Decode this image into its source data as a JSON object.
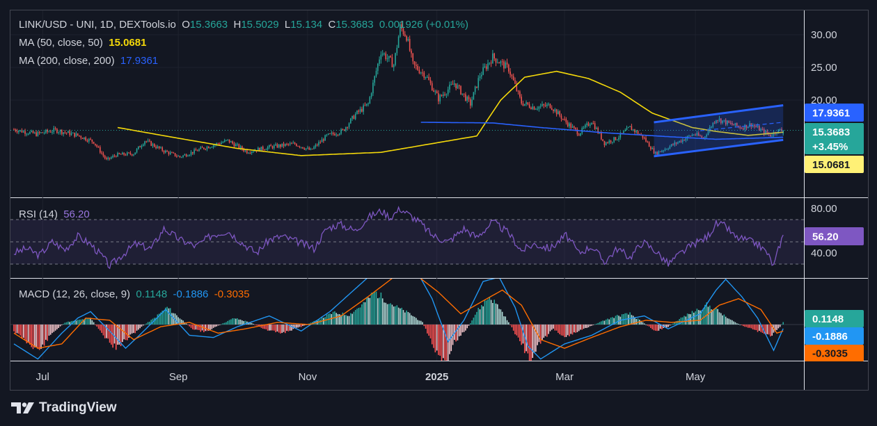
{
  "header": {
    "symbol": "LINK/USD - UNI, 1D, DEXTools.io",
    "open_label": "O",
    "open": "15.3663",
    "high_label": "H",
    "high": "15.5029",
    "low_label": "L",
    "low": "15.134",
    "close_label": "C",
    "close": "15.3683",
    "change": "0.001926 (+0.01%)"
  },
  "ma50": {
    "label": "MA (50, close, 50)",
    "value": "15.0681",
    "color": "#f5d90a"
  },
  "ma200": {
    "label": "MA (200, close, 200)",
    "value": "17.9361",
    "color": "#2962ff"
  },
  "rsi": {
    "label": "RSI (14)",
    "value": "56.20",
    "color": "#7e57c2"
  },
  "macd": {
    "label": "MACD (12, 26, close, 9)",
    "hist": "0.1148",
    "macd": "-0.1886",
    "signal": "-0.3035"
  },
  "badges": {
    "ma200": "17.9361",
    "price": "15.3683",
    "pct": "+3.45%",
    "ma50": "15.0681",
    "rsi": "56.20",
    "hist": "0.1148",
    "macd": "-0.1886",
    "signal": "-0.3035"
  },
  "colors": {
    "up": "#26a69a",
    "down": "#ef5350",
    "bg": "#131722",
    "text": "#d1d4dc",
    "macd": "#2196f3",
    "signal": "#ff6d00",
    "channel": "#2962ff"
  },
  "brand": "TradingView",
  "chart_data": [
    {
      "type": "candlestick",
      "title": "LINK/USD - UNI, 1D, DEXTools.io",
      "x_ticks": [
        "Jul",
        "Sep",
        "Nov",
        "2025",
        "Mar",
        "May"
      ],
      "y_ticks": [
        "30.00",
        "25.00",
        "20.00"
      ],
      "ylim": [
        8,
        32
      ],
      "current": {
        "open": 15.3663,
        "high": 15.5029,
        "low": 15.134,
        "close": 15.3683
      },
      "waypoints": [
        [
          0,
          15.5
        ],
        [
          14,
          14.8
        ],
        [
          26,
          15.4
        ],
        [
          40,
          14.6
        ],
        [
          50,
          13.6
        ],
        [
          58,
          10.8
        ],
        [
          64,
          11.6
        ],
        [
          75,
          11.8
        ],
        [
          82,
          13.8
        ],
        [
          94,
          12.2
        ],
        [
          104,
          11.3
        ],
        [
          118,
          12.6
        ],
        [
          134,
          13.8
        ],
        [
          146,
          12.1
        ],
        [
          160,
          12.8
        ],
        [
          176,
          13.3
        ],
        [
          186,
          12.3
        ],
        [
          196,
          14.5
        ],
        [
          206,
          15.3
        ],
        [
          214,
          17.8
        ],
        [
          222,
          19.4
        ],
        [
          230,
          27.5
        ],
        [
          238,
          25.4
        ],
        [
          242,
          31.2
        ],
        [
          246,
          29.8
        ],
        [
          250,
          25.4
        ],
        [
          258,
          23.8
        ],
        [
          266,
          20.2
        ],
        [
          276,
          22.6
        ],
        [
          286,
          19.4
        ],
        [
          292,
          23.8
        ],
        [
          300,
          26.6
        ],
        [
          310,
          24.8
        ],
        [
          318,
          19.6
        ],
        [
          326,
          18.9
        ],
        [
          336,
          19.2
        ],
        [
          346,
          16.6
        ],
        [
          354,
          14.9
        ],
        [
          362,
          16.8
        ],
        [
          370,
          13.4
        ],
        [
          378,
          14.2
        ],
        [
          386,
          15.8
        ],
        [
          394,
          14.4
        ],
        [
          402,
          11.8
        ],
        [
          410,
          12.8
        ],
        [
          418,
          13.8
        ],
        [
          426,
          14.8
        ],
        [
          432,
          14.2
        ],
        [
          440,
          17.2
        ],
        [
          448,
          16.4
        ],
        [
          456,
          15.8
        ],
        [
          462,
          16.3
        ],
        [
          470,
          15.1
        ],
        [
          474,
          14.6
        ],
        [
          478,
          15.3
        ],
        [
          482,
          15.37
        ]
      ],
      "series": [
        {
          "name": "MA (50, close, 50)",
          "waypoints": [
            [
              65,
              15.8
            ],
            [
              95,
              14.5
            ],
            [
              140,
              12.6
            ],
            [
              180,
              11.5
            ],
            [
              230,
              12.0
            ],
            [
              290,
              14.5
            ],
            [
              305,
              20.0
            ],
            [
              320,
              23.5
            ],
            [
              340,
              24.4
            ],
            [
              360,
              23.3
            ],
            [
              380,
              21.2
            ],
            [
              400,
              18.0
            ],
            [
              425,
              15.8
            ],
            [
              440,
              15.2
            ],
            [
              460,
              14.6
            ],
            [
              482,
              15.07
            ]
          ]
        },
        {
          "name": "MA (200, close, 200)",
          "waypoints": [
            [
              255,
              16.6
            ],
            [
              300,
              16.5
            ],
            [
              330,
              15.8
            ],
            [
              370,
              15.0
            ],
            [
              410,
              14.4
            ],
            [
              440,
              14.0
            ],
            [
              482,
              14.3
            ]
          ]
        }
      ],
      "channel": {
        "upper": [
          [
            401,
            16.6
          ],
          [
            482,
            19.2
          ]
        ],
        "lower": [
          [
            401,
            11.4
          ],
          [
            482,
            13.9
          ]
        ],
        "mid": [
          [
            430,
            15.3
          ],
          [
            482,
            16.6
          ]
        ]
      }
    },
    {
      "type": "line",
      "title": "RSI (14)",
      "y_ticks": [
        "80.00",
        "40.00"
      ],
      "ylim": [
        20,
        82
      ],
      "bands": [
        70,
        50,
        30
      ],
      "waypoints": [
        [
          0,
          40
        ],
        [
          8,
          44
        ],
        [
          16,
          38
        ],
        [
          24,
          50
        ],
        [
          32,
          43
        ],
        [
          40,
          55
        ],
        [
          48,
          48
        ],
        [
          56,
          36
        ],
        [
          60,
          28
        ],
        [
          66,
          36
        ],
        [
          76,
          48
        ],
        [
          86,
          44
        ],
        [
          94,
          62
        ],
        [
          104,
          52
        ],
        [
          114,
          46
        ],
        [
          124,
          56
        ],
        [
          134,
          60
        ],
        [
          144,
          48
        ],
        [
          152,
          40
        ],
        [
          160,
          52
        ],
        [
          168,
          55
        ],
        [
          178,
          50
        ],
        [
          188,
          44
        ],
        [
          196,
          62
        ],
        [
          204,
          66
        ],
        [
          214,
          60
        ],
        [
          222,
          72
        ],
        [
          230,
          78
        ],
        [
          236,
          72
        ],
        [
          242,
          80
        ],
        [
          248,
          74
        ],
        [
          254,
          68
        ],
        [
          262,
          56
        ],
        [
          272,
          50
        ],
        [
          282,
          62
        ],
        [
          290,
          54
        ],
        [
          300,
          68
        ],
        [
          310,
          58
        ],
        [
          318,
          42
        ],
        [
          326,
          48
        ],
        [
          336,
          44
        ],
        [
          346,
          56
        ],
        [
          354,
          40
        ],
        [
          362,
          46
        ],
        [
          370,
          32
        ],
        [
          378,
          44
        ],
        [
          386,
          36
        ],
        [
          394,
          50
        ],
        [
          402,
          42
        ],
        [
          410,
          30
        ],
        [
          418,
          40
        ],
        [
          426,
          48
        ],
        [
          434,
          54
        ],
        [
          440,
          66
        ],
        [
          446,
          64
        ],
        [
          452,
          54
        ],
        [
          458,
          52
        ],
        [
          466,
          48
        ],
        [
          472,
          40
        ],
        [
          476,
          28
        ],
        [
          480,
          48
        ],
        [
          482,
          56.2
        ]
      ]
    },
    {
      "type": "bar",
      "title": "MACD (12, 26, close, 9)",
      "ylim": [
        -1.9,
        1.9
      ],
      "histogram_waypoints": [
        [
          0,
          -0.3
        ],
        [
          8,
          -0.8
        ],
        [
          16,
          -1.2
        ],
        [
          24,
          -0.4
        ],
        [
          32,
          0.1
        ],
        [
          40,
          0.2
        ],
        [
          48,
          0.3
        ],
        [
          56,
          -0.5
        ],
        [
          64,
          -1.1
        ],
        [
          72,
          -0.6
        ],
        [
          80,
          -0.1
        ],
        [
          88,
          0.3
        ],
        [
          96,
          0.8
        ],
        [
          104,
          0.3
        ],
        [
          112,
          -0.2
        ],
        [
          120,
          -0.35
        ],
        [
          128,
          -0.05
        ],
        [
          138,
          0.3
        ],
        [
          148,
          0.1
        ],
        [
          158,
          -0.25
        ],
        [
          168,
          -0.4
        ],
        [
          180,
          -0.1
        ],
        [
          190,
          0.2
        ],
        [
          200,
          0.55
        ],
        [
          210,
          0.45
        ],
        [
          218,
          0.9
        ],
        [
          226,
          1.5
        ],
        [
          232,
          1.2
        ],
        [
          240,
          0.8
        ],
        [
          248,
          0.5
        ],
        [
          256,
          0.1
        ],
        [
          264,
          -1.2
        ],
        [
          270,
          -1.95
        ],
        [
          276,
          -0.8
        ],
        [
          284,
          -0.2
        ],
        [
          290,
          0.6
        ],
        [
          298,
          1.3
        ],
        [
          304,
          0.8
        ],
        [
          310,
          0.1
        ],
        [
          318,
          -0.9
        ],
        [
          324,
          -1.7
        ],
        [
          330,
          -0.8
        ],
        [
          338,
          -0.2
        ],
        [
          346,
          -0.6
        ],
        [
          354,
          -0.3
        ],
        [
          362,
          -0.05
        ],
        [
          370,
          0.2
        ],
        [
          378,
          0.4
        ],
        [
          386,
          0.5
        ],
        [
          394,
          0.1
        ],
        [
          402,
          -0.3
        ],
        [
          410,
          -0.1
        ],
        [
          418,
          0.3
        ],
        [
          426,
          0.6
        ],
        [
          434,
          0.9
        ],
        [
          440,
          0.7
        ],
        [
          446,
          0.35
        ],
        [
          452,
          0.1
        ],
        [
          458,
          -0.1
        ],
        [
          466,
          -0.3
        ],
        [
          474,
          -0.55
        ],
        [
          480,
          -0.1
        ],
        [
          482,
          0.1148
        ]
      ],
      "series": [
        {
          "name": "MACD",
          "waypoints": [
            [
              0,
              -0.9
            ],
            [
              15,
              -1.6
            ],
            [
              30,
              -0.4
            ],
            [
              40,
              0.3
            ],
            [
              48,
              0.6
            ],
            [
              60,
              -0.3
            ],
            [
              70,
              -1.1
            ],
            [
              80,
              -0.4
            ],
            [
              95,
              0.7
            ],
            [
              110,
              -0.5
            ],
            [
              125,
              -0.6
            ],
            [
              140,
              -0.1
            ],
            [
              160,
              0.4
            ],
            [
              180,
              -0.3
            ],
            [
              198,
              0.6
            ],
            [
              210,
              1.4
            ],
            [
              222,
              2.2
            ],
            [
              236,
              3.2
            ],
            [
              250,
              2.8
            ],
            [
              262,
              1.2
            ],
            [
              272,
              -0.8
            ],
            [
              282,
              0.2
            ],
            [
              294,
              2.0
            ],
            [
              304,
              2.2
            ],
            [
              314,
              0.8
            ],
            [
              322,
              -1.0
            ],
            [
              330,
              -1.6
            ],
            [
              345,
              -0.9
            ],
            [
              362,
              -0.5
            ],
            [
              380,
              0.2
            ],
            [
              395,
              0.4
            ],
            [
              410,
              -0.2
            ],
            [
              430,
              0.5
            ],
            [
              440,
              1.6
            ],
            [
              446,
              2.1
            ],
            [
              456,
              1.3
            ],
            [
              466,
              0.3
            ],
            [
              476,
              -1.2
            ],
            [
              482,
              -0.19
            ]
          ]
        },
        {
          "name": "Signal",
          "waypoints": [
            [
              0,
              -0.4
            ],
            [
              15,
              -1.1
            ],
            [
              30,
              -0.9
            ],
            [
              45,
              0.3
            ],
            [
              60,
              0.2
            ],
            [
              75,
              -0.7
            ],
            [
              92,
              -0.1
            ],
            [
              110,
              0.1
            ],
            [
              128,
              -0.4
            ],
            [
              145,
              -0.2
            ],
            [
              165,
              0.1
            ],
            [
              185,
              0.0
            ],
            [
              205,
              0.4
            ],
            [
              222,
              1.3
            ],
            [
              238,
              2.2
            ],
            [
              252,
              2.3
            ],
            [
              266,
              1.5
            ],
            [
              280,
              0.5
            ],
            [
              294,
              1.1
            ],
            [
              306,
              1.6
            ],
            [
              318,
              0.9
            ],
            [
              330,
              -0.7
            ],
            [
              345,
              -1.1
            ],
            [
              362,
              -0.6
            ],
            [
              380,
              -0.1
            ],
            [
              396,
              0.2
            ],
            [
              412,
              0.1
            ],
            [
              430,
              0.2
            ],
            [
              442,
              0.9
            ],
            [
              454,
              1.2
            ],
            [
              468,
              0.7
            ],
            [
              478,
              -0.4
            ],
            [
              482,
              -0.3
            ]
          ]
        }
      ]
    }
  ]
}
